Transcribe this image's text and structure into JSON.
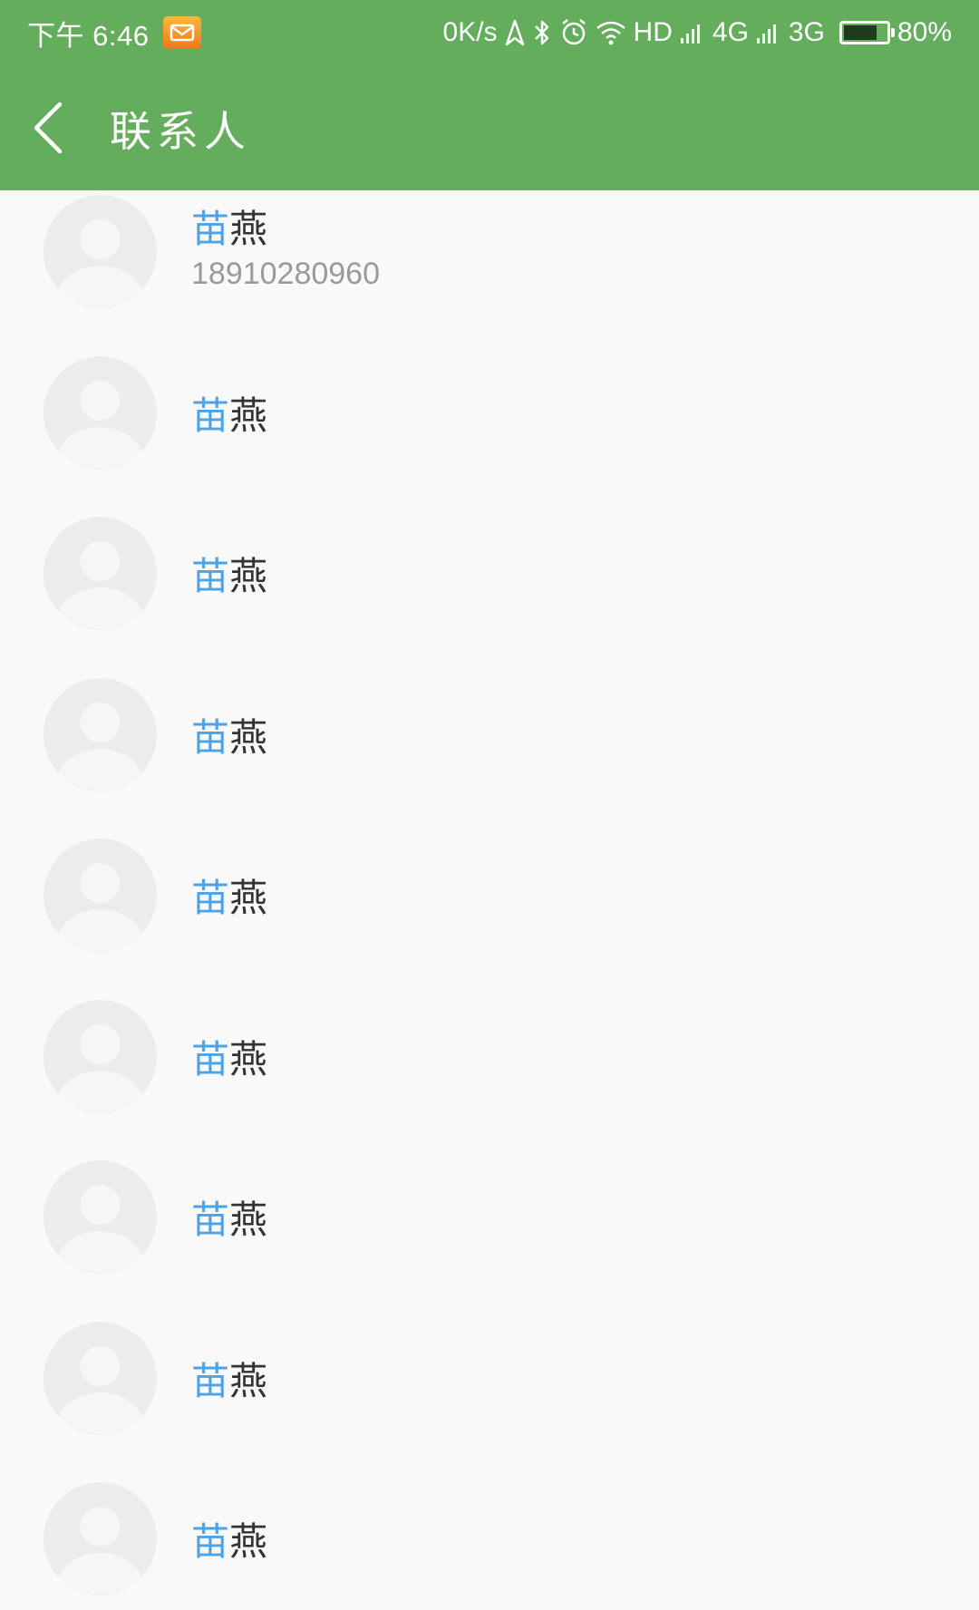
{
  "status_bar": {
    "time": "下午 6:46",
    "network_speed": "0K/s",
    "hd_label": "HD",
    "network_4g": "4G",
    "network_3g": "3G",
    "battery": "80%",
    "battery_level": 0.8,
    "icons": [
      "mail-icon",
      "location-icon",
      "bluetooth-icon",
      "alarm-icon",
      "wifi-icon",
      "signal-icon",
      "battery-icon"
    ]
  },
  "title_bar": {
    "title": "联系人",
    "back_icon": "chevron-left-icon"
  },
  "colors": {
    "header": "#64ad5d",
    "background": "#f9f9f9",
    "name_highlight": "#4da3e8",
    "name_text": "#333333",
    "phone_text": "#9a9a9a"
  },
  "contacts": [
    {
      "name_highlight": "苗",
      "name_rest": "燕",
      "phone": "18910280960"
    },
    {
      "name_highlight": "苗",
      "name_rest": "燕"
    },
    {
      "name_highlight": "苗",
      "name_rest": "燕"
    },
    {
      "name_highlight": "苗",
      "name_rest": "燕"
    },
    {
      "name_highlight": "苗",
      "name_rest": "燕"
    },
    {
      "name_highlight": "苗",
      "name_rest": "燕"
    },
    {
      "name_highlight": "苗",
      "name_rest": "燕"
    },
    {
      "name_highlight": "苗",
      "name_rest": "燕"
    },
    {
      "name_highlight": "苗",
      "name_rest": "燕"
    }
  ]
}
